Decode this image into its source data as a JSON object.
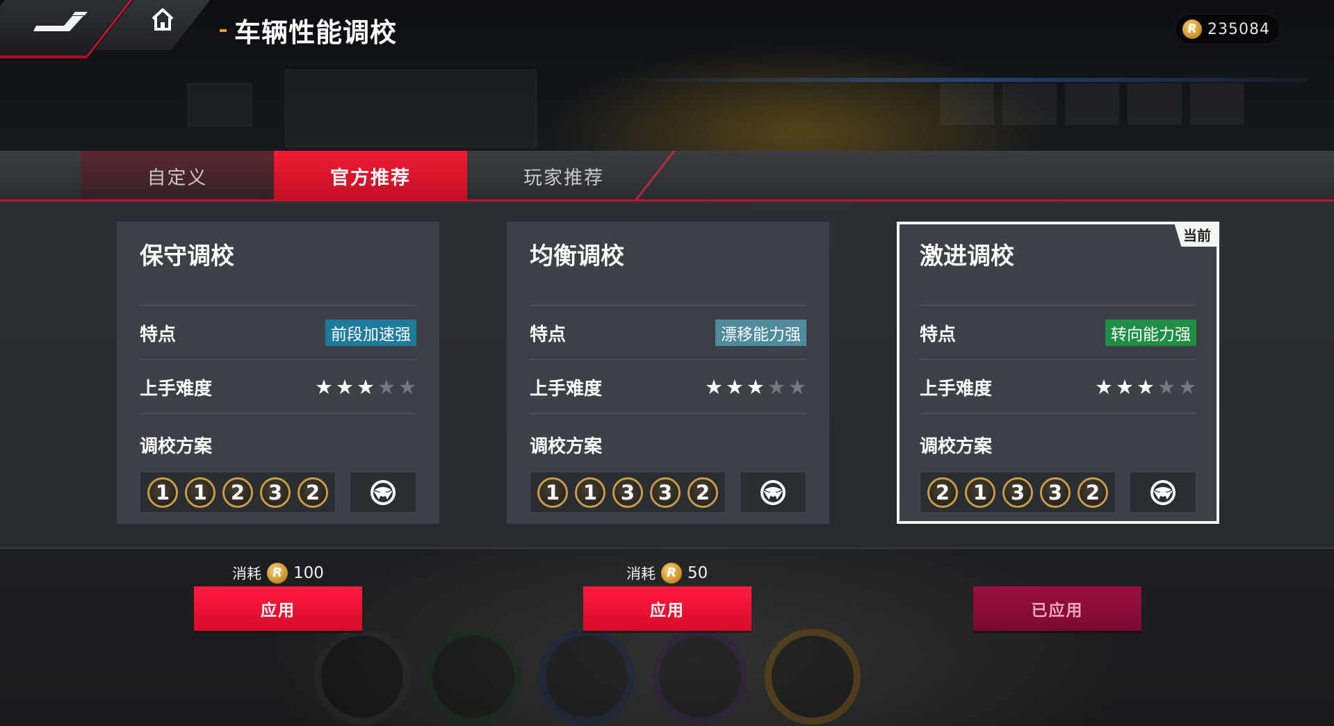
{
  "header": {
    "title": "车辆性能调校",
    "coins": "235084"
  },
  "tabs": [
    {
      "label": "自定义",
      "active": false
    },
    {
      "label": "官方推荐",
      "active": true
    },
    {
      "label": "玩家推荐",
      "active": false
    }
  ],
  "cards": [
    {
      "title": "保守调校",
      "feature_label": "特点",
      "feature_tag": "前段加速强",
      "difficulty_label": "上手难度",
      "difficulty_stars": 3,
      "difficulty_max": 5,
      "scheme_label": "调校方案",
      "scheme": [
        "1",
        "1",
        "2",
        "3",
        "2"
      ],
      "current": false,
      "cost_label": "消耗",
      "cost_value": "100",
      "button_label": "应用"
    },
    {
      "title": "均衡调校",
      "feature_label": "特点",
      "feature_tag": "漂移能力强",
      "difficulty_label": "上手难度",
      "difficulty_stars": 3,
      "difficulty_max": 5,
      "scheme_label": "调校方案",
      "scheme": [
        "1",
        "1",
        "3",
        "3",
        "2"
      ],
      "current": false,
      "cost_label": "消耗",
      "cost_value": "50",
      "button_label": "应用"
    },
    {
      "title": "激进调校",
      "feature_label": "特点",
      "feature_tag": "转向能力强",
      "difficulty_label": "上手难度",
      "difficulty_stars": 3,
      "difficulty_max": 5,
      "scheme_label": "调校方案",
      "scheme": [
        "2",
        "1",
        "3",
        "3",
        "2"
      ],
      "current": true,
      "current_badge": "当前",
      "button_label": "已应用"
    }
  ],
  "colors": {
    "accent_red": "#e01030",
    "tag_blue": "#1f7b9c",
    "tag_teal": "#4e8c9c",
    "tag_green": "#1f8f45",
    "applied_button": "#8a0c38"
  },
  "icons": {
    "logo": "brand-logo-icon",
    "home": "home-icon",
    "coin": "coin-icon",
    "steering": "steering-wheel-icon",
    "star": "star-icon"
  }
}
